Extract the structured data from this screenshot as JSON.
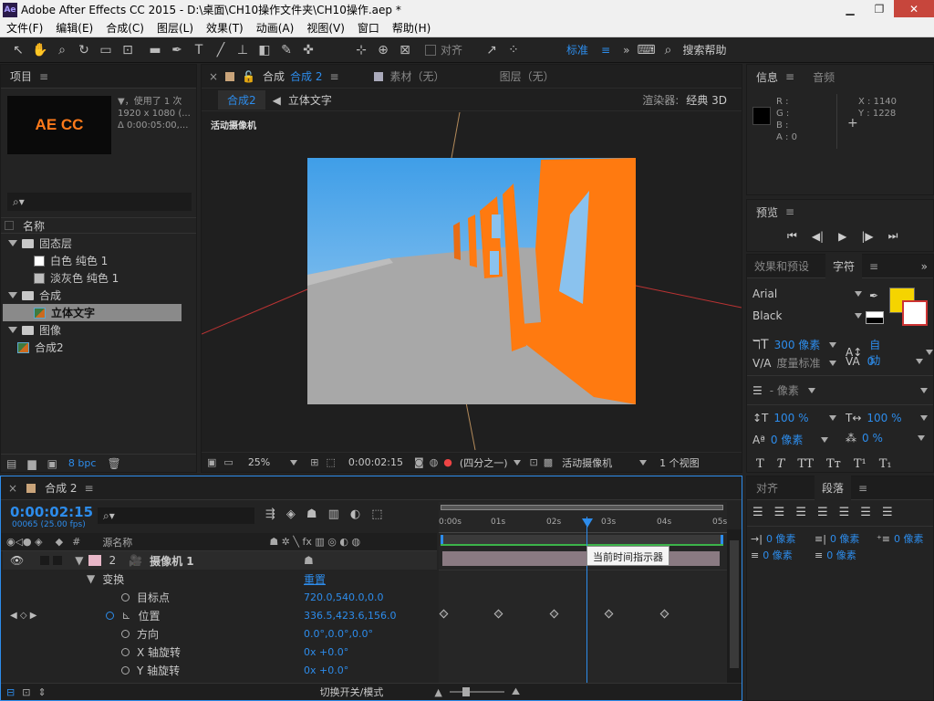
{
  "window": {
    "logo": "Ae",
    "title": "Adobe After Effects CC 2015 - D:\\桌面\\CH10操作文件夹\\CH10操作.aep *"
  },
  "menu": [
    "文件(F)",
    "编辑(E)",
    "合成(C)",
    "图层(L)",
    "效果(T)",
    "动画(A)",
    "视图(V)",
    "窗口",
    "帮助(H)"
  ],
  "toolbar": {
    "snap_label": "对齐",
    "workspace": "标准",
    "search_placeholder": "搜索帮助"
  },
  "project": {
    "tab": "项目",
    "thumb_text": "AE CC",
    "info_line1": "▼，使用了 1 次",
    "info_line2": "1920 x 1080 (...",
    "info_line3": "Δ 0:00:05:00,...",
    "col_name": "名称",
    "items": [
      {
        "label": "固态层",
        "kind": "folder",
        "indent": 0
      },
      {
        "label": "白色 纯色 1",
        "kind": "solid",
        "indent": 1,
        "color": "#ffffff"
      },
      {
        "label": "淡灰色 纯色 1",
        "kind": "solid",
        "indent": 1,
        "color": "#bdbdbd"
      },
      {
        "label": "合成",
        "kind": "folder",
        "indent": 0
      },
      {
        "label": "立体文字",
        "kind": "comp",
        "indent": 1,
        "selected": true
      },
      {
        "label": "图像",
        "kind": "folder",
        "indent": 0
      },
      {
        "label": "合成2",
        "kind": "comp",
        "indent": 0
      }
    ],
    "bpc": "8 bpc"
  },
  "comp_viewer": {
    "tab_comp": "合成",
    "tab_comp_name": "合成 2",
    "tab_footage": "素材（无）",
    "tab_layer": "图层（无）",
    "breadcrumb_1": "合成2",
    "breadcrumb_2": "立体文字",
    "renderer_label": "渲染器:",
    "renderer_value": "经典 3D",
    "active_camera": "活动摄像机",
    "zoom": "25%",
    "timecode": "0:00:02:15",
    "resolution": "(四分之一)",
    "view_camera": "活动摄像机",
    "views": "1 个视图"
  },
  "info": {
    "tab_info": "信息",
    "tab_audio": "音频",
    "r": "R :",
    "g": "G :",
    "b": "B :",
    "a": "A : 0",
    "x": "X : 1140",
    "y": "Y : 1228"
  },
  "preview": {
    "tab": "预览"
  },
  "character": {
    "tab_effects": "效果和预设",
    "tab_char": "字符",
    "font": "Arial",
    "style": "Black",
    "size": "300 像素",
    "leading": "自动",
    "kerning": "度量标准",
    "tracking": "0",
    "stroke": "- 像素",
    "vscale": "100 %",
    "hscale": "100 %",
    "baseline": "0 像素",
    "tsume": "0 %",
    "fill_color": "#f5d400"
  },
  "paragraph": {
    "tab_align": "对齐",
    "tab_para": "段落",
    "indent_left": "0 像素",
    "indent_right": "0 像素",
    "indent_first": "0 像素",
    "space_before": "0 像素",
    "space_after": "0 像素"
  },
  "timeline": {
    "tab": "合成 2",
    "timecode": "0:00:02:15",
    "frames": "00065 (25.00 fps)",
    "col_hash": "#",
    "col_source": "源名称",
    "ruler": [
      "0:00s",
      "01s",
      "02s",
      "03s",
      "04s",
      "05s"
    ],
    "tooltip": "当前时间指示器",
    "layer_num": "2",
    "layer_name": "摄像机 1",
    "transform": "变换",
    "reset": "重置",
    "props": [
      {
        "label": "目标点",
        "value": "720.0,540.0,0.0"
      },
      {
        "label": "位置",
        "value": "336.5,423.6,156.0"
      },
      {
        "label": "方向",
        "value": "0.0°,0.0°,0.0°"
      },
      {
        "label": "X 轴旋转",
        "value": "0x +0.0°"
      },
      {
        "label": "Y 轴旋转",
        "value": "0x +0.0°"
      }
    ],
    "toggle_label": "切换开关/模式"
  }
}
